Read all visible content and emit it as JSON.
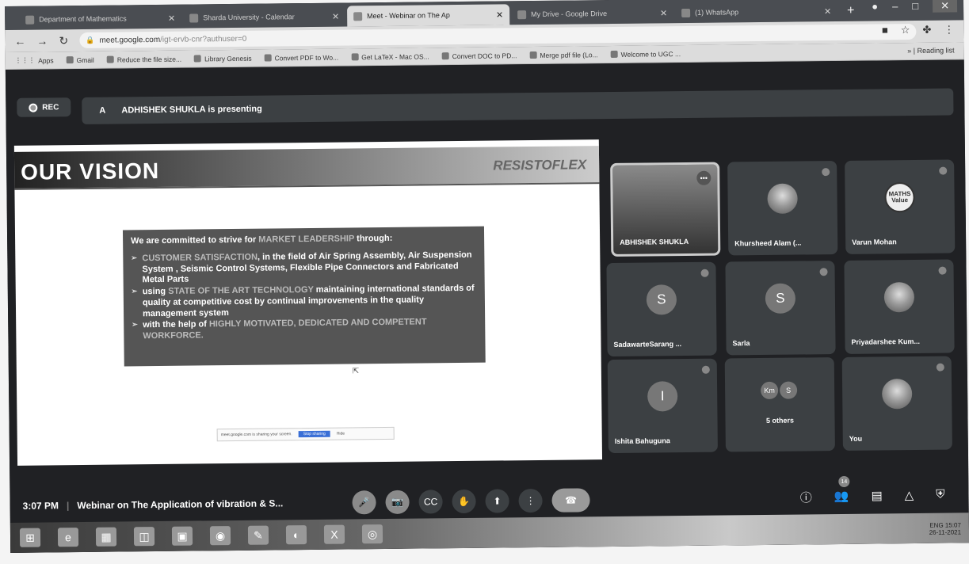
{
  "browser": {
    "tabs": [
      {
        "title": "Department of Mathematics",
        "active": false
      },
      {
        "title": "Sharda University - Calendar",
        "active": false
      },
      {
        "title": "Meet - Webinar on The Ap",
        "active": true
      },
      {
        "title": "My Drive - Google Drive",
        "active": false
      },
      {
        "title": "(1) WhatsApp",
        "active": false
      }
    ],
    "url_host": "meet.google.com",
    "url_rest": "/igt-ervb-cnr?authuser=0",
    "bookmarks": [
      "Apps",
      "Gmail",
      "Reduce the file size...",
      "Library Genesis",
      "Convert PDF to Wo...",
      "Get LaTeX - Mac OS...",
      "Convert DOC to PD...",
      "Merge pdf file (Lo...",
      "Welcome to UGC ..."
    ],
    "reading_list": "Reading list"
  },
  "meet": {
    "rec_label": "REC",
    "presenter_initial": "A",
    "presenting_text": "ADHISHEK SHUKLA is presenting",
    "time": "3:07 PM",
    "meeting_title": "Webinar on The Application of vibration & S...",
    "people_badge": "14"
  },
  "slide": {
    "title": "OUR VISION",
    "brand": "RESISTOFLEX",
    "intro": "We are committed to strive for ",
    "intro_hl": "MARKET LEADERSHIP",
    "intro_end": " through:",
    "b1_hl": "CUSTOMER SATISFACTION",
    "b1": ", in the field of Air Spring Assembly, Air Suspension System , Seismic Control Systems, Flexible Pipe Connectors and Fabricated Metal Parts",
    "b2_pre": "using ",
    "b2_hl": "STATE OF THE ART TECHNOLOGY",
    "b2": " maintaining international standards of quality at competitive cost by continual improvements in the quality management system",
    "b3_pre": "with the help of ",
    "b3_hl": "HIGHLY MOTIVATED, DEDICATED AND COMPETENT WORKFORCE.",
    "share_text": "meet.google.com is sharing your screen.",
    "share_stop": "Stop sharing",
    "share_hide": "Hide"
  },
  "participants": [
    {
      "name": "ABHISHEK SHUKLA",
      "avatar": ""
    },
    {
      "name": "Khursheed Alam (...",
      "avatar": ""
    },
    {
      "name": "Varun Mohan",
      "avatar": "MATHS Value"
    },
    {
      "name": "SadawarteSarang ...",
      "avatar": "S"
    },
    {
      "name": "Sarla",
      "avatar": "S"
    },
    {
      "name": "Priyadarshee Kum...",
      "avatar": ""
    },
    {
      "name": "Ishita Bahuguna",
      "avatar": "I"
    },
    {
      "name": "5 others",
      "avatar": "Km S"
    },
    {
      "name": "You",
      "avatar": ""
    }
  ],
  "taskbar": {
    "clock_time": "15:07",
    "clock_date": "26-11-2021",
    "lang": "ENG"
  }
}
